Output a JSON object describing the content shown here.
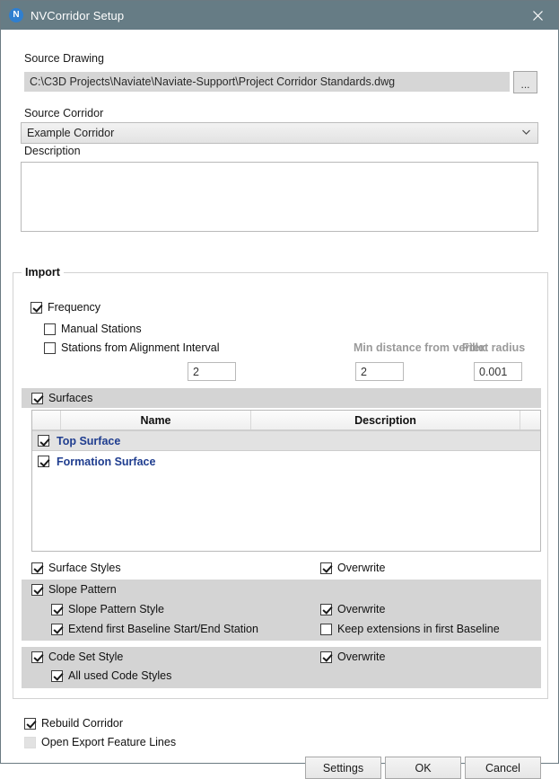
{
  "window": {
    "title": "NVCorridor Setup",
    "app_icon_letter": "N",
    "close_icon": "close-icon",
    "titlebar_color": "#667c85",
    "accent_color": "#2f7fd0",
    "link_color": "#1f3d8f"
  },
  "source_drawing": {
    "label": "Source Drawing",
    "value": "C:\\C3D Projects\\Naviate\\Naviate-Support\\Project Corridor Standards.dwg",
    "browse_label": "..."
  },
  "source_corridor": {
    "label": "Source Corridor",
    "value": "Example Corridor",
    "chevron": "⌄"
  },
  "description": {
    "label": "Description",
    "value": "",
    "placeholder": ""
  },
  "import": {
    "legend": "Import",
    "frequency": {
      "label": "Frequency",
      "checked": true
    },
    "manual_stations": {
      "label": "Manual Stations",
      "checked": false
    },
    "stations_from_alignment": {
      "label": "Stations from Alignment Interval",
      "checked": false
    },
    "min_distance_label": "Min distance from vertex",
    "fillet_radius_label": "Fillet radius",
    "interval_value": "2",
    "min_distance_value": "2",
    "fillet_radius_value": "0.001",
    "surfaces": {
      "label": "Surfaces",
      "checked": true,
      "columns": [
        "",
        "Name",
        "Description",
        ""
      ],
      "rows": [
        {
          "checked": true,
          "name": "Top Surface",
          "description": "",
          "selected": true
        },
        {
          "checked": true,
          "name": "Formation Surface",
          "description": "",
          "selected": false
        }
      ]
    },
    "surface_styles": {
      "label": "Surface Styles",
      "checked": true
    },
    "surface_styles_overwrite": {
      "label": "Overwrite",
      "checked": true
    },
    "slope_pattern": {
      "label": "Slope Pattern",
      "checked": true
    },
    "slope_pattern_style": {
      "label": "Slope Pattern Style",
      "checked": true
    },
    "slope_pattern_overwrite": {
      "label": "Overwrite",
      "checked": true
    },
    "extend_first_baseline": {
      "label": "Extend first Baseline Start/End Station",
      "checked": true
    },
    "keep_extensions": {
      "label": "Keep extensions in first Baseline",
      "checked": false
    },
    "code_set_style": {
      "label": "Code Set Style",
      "checked": true
    },
    "code_set_overwrite": {
      "label": "Overwrite",
      "checked": true
    },
    "all_used_code_styles": {
      "label": "All used Code Styles",
      "checked": true
    }
  },
  "footer": {
    "rebuild_corridor": {
      "label": "Rebuild Corridor",
      "checked": true
    },
    "open_export_feature_lines": {
      "label": "Open Export Feature Lines",
      "checked": false,
      "disabled": true
    },
    "buttons": {
      "settings": "Settings",
      "ok": "OK",
      "cancel": "Cancel"
    }
  }
}
